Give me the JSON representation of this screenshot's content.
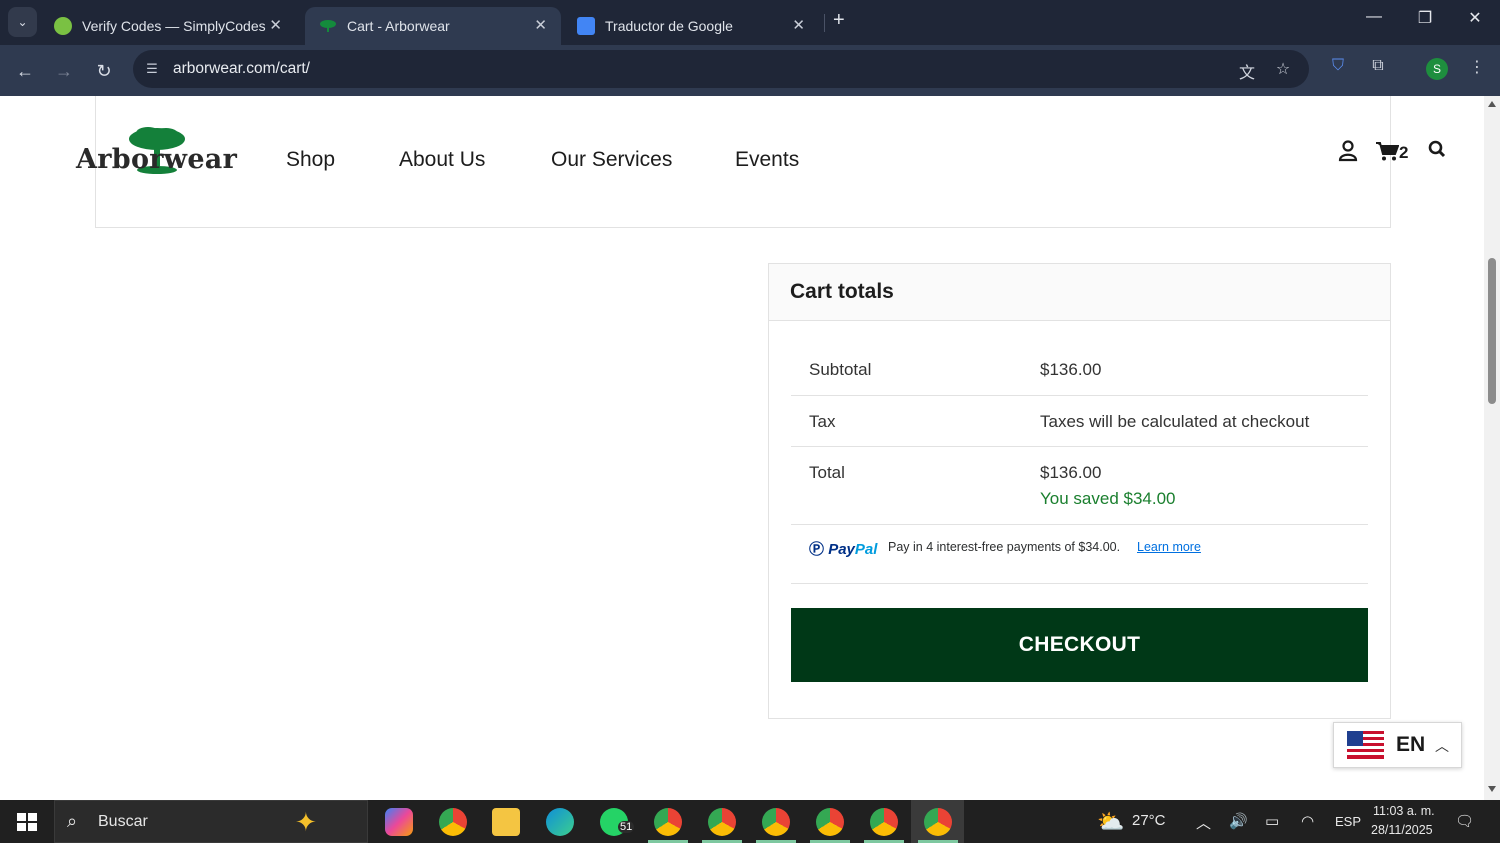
{
  "browser": {
    "tabs": [
      {
        "title": "Verify Codes — SimplyCodes",
        "active": false
      },
      {
        "title": "Cart - Arborwear",
        "active": true
      },
      {
        "title": "Traductor de Google",
        "active": false
      }
    ],
    "url": "arborwear.com/cart/",
    "profile_initial": "S"
  },
  "site": {
    "logo_text": "Arborwear",
    "nav": [
      "Shop",
      "About Us",
      "Our Services",
      "Events"
    ],
    "cart_count": "2"
  },
  "cart_totals": {
    "title": "Cart totals",
    "subtotal_label": "Subtotal",
    "subtotal_value": "$136.00",
    "tax_label": "Tax",
    "tax_value": "Taxes will be calculated at checkout",
    "total_label": "Total",
    "total_value": "$136.00",
    "saved_text": "You saved $34.00",
    "paypal_brand_a": "Pay",
    "paypal_brand_b": "Pal",
    "paypal_message": "Pay in 4 interest-free payments of $34.00.",
    "paypal_link": "Learn more",
    "checkout_label": "CHECKOUT"
  },
  "language_switcher": {
    "code": "EN"
  },
  "taskbar": {
    "search_placeholder": "Buscar",
    "weather": "27°C",
    "language": "ESP",
    "time": "11:03 a. m.",
    "date": "28/11/2025",
    "whatsapp_badge": "51"
  },
  "colors": {
    "checkout_bg": "#003817",
    "saved_text": "#1a7f2e",
    "tab_bar": "#1f2637",
    "toolbar": "#2f3a50"
  }
}
